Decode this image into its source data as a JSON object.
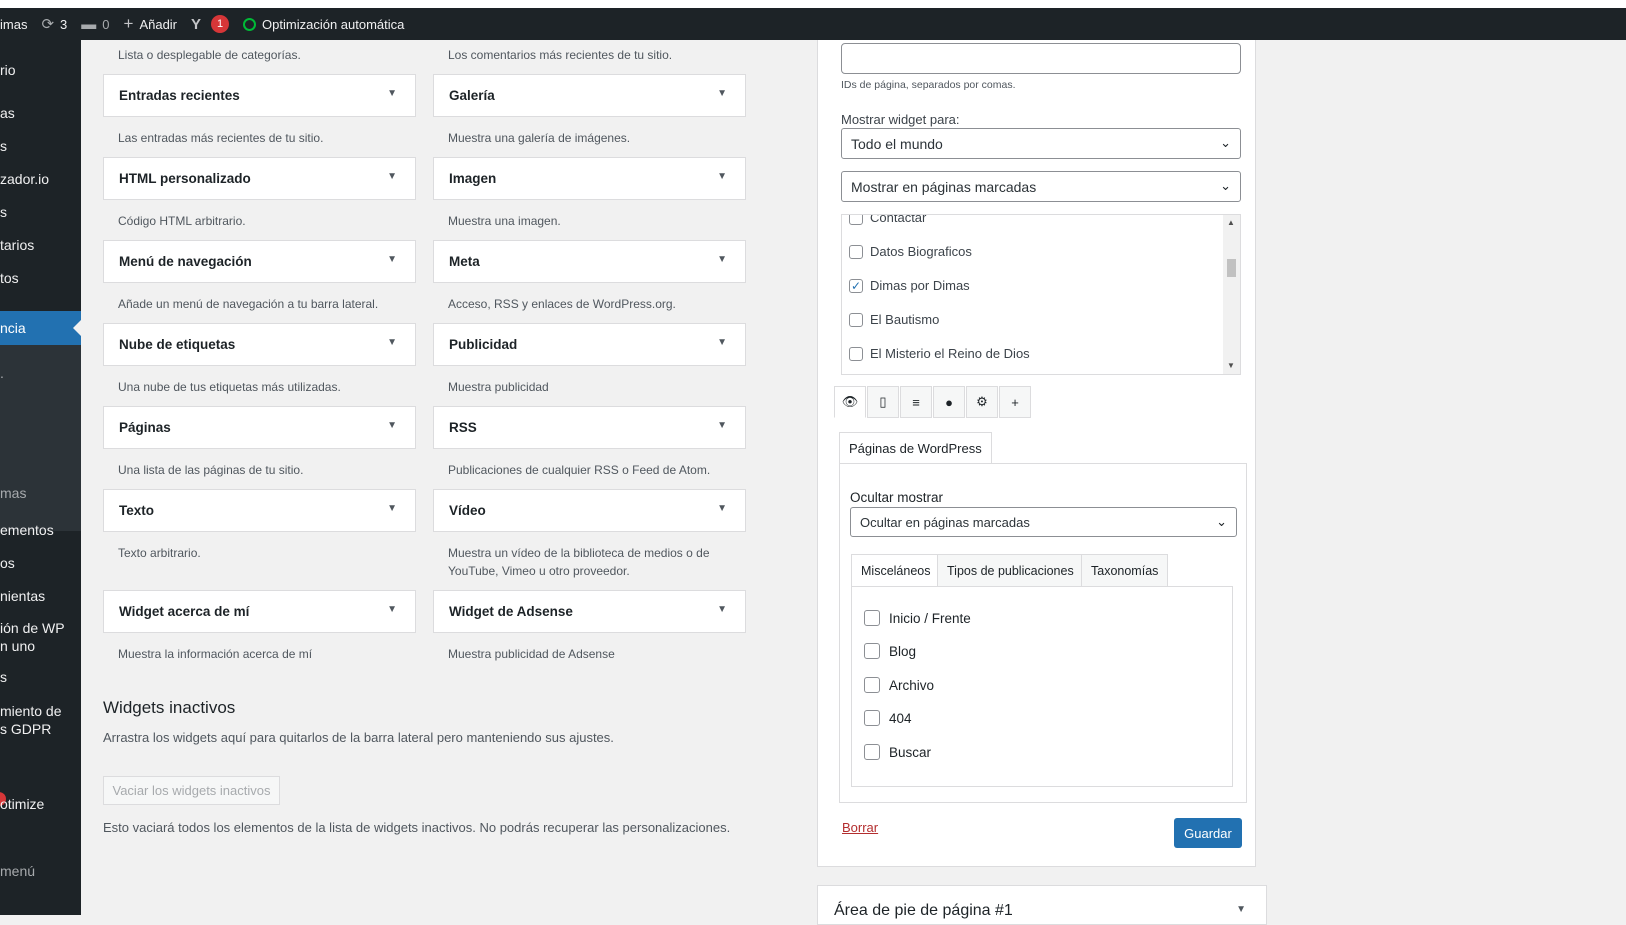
{
  "adminbar": {
    "site_name": "imas",
    "updates_count": "3",
    "comments_count": "0",
    "add_new": "Añadir",
    "yoast_badge": "1",
    "autoptimize": "Optimización automática"
  },
  "sidebar": {
    "items": [
      "rio",
      "as",
      "s",
      "zador.io",
      "s",
      "tarios",
      "tos",
      "ncia",
      ".",
      "mas",
      "ementos",
      "os",
      "nientas",
      "ión de WP",
      "n uno",
      "s",
      "miento de",
      "s GDPR",
      "otimize",
      "menú"
    ]
  },
  "widgets": {
    "top_desc_left": "Lista o desplegable de categorías.",
    "top_desc_right": "Los comentarios más recientes de tu sitio.",
    "left": [
      {
        "title": "Entradas recientes",
        "desc": "Las entradas más recientes de tu sitio."
      },
      {
        "title": "HTML personalizado",
        "desc": "Código HTML arbitrario."
      },
      {
        "title": "Menú de navegación",
        "desc": "Añade un menú de navegación a tu barra lateral."
      },
      {
        "title": "Nube de etiquetas",
        "desc": "Una nube de tus etiquetas más utilizadas."
      },
      {
        "title": "Páginas",
        "desc": "Una lista de las páginas de tu sitio."
      },
      {
        "title": "Texto",
        "desc": "Texto arbitrario."
      },
      {
        "title": "Widget acerca de mí",
        "desc": "Muestra la información acerca de mí"
      }
    ],
    "right": [
      {
        "title": "Galería",
        "desc": "Muestra una galería de imágenes."
      },
      {
        "title": "Imagen",
        "desc": "Muestra una imagen."
      },
      {
        "title": "Meta",
        "desc": "Acceso, RSS y enlaces de WordPress.org."
      },
      {
        "title": "Publicidad",
        "desc": "Muestra publicidad"
      },
      {
        "title": "RSS",
        "desc": "Publicaciones de cualquier RSS o Feed de Atom."
      },
      {
        "title": "Vídeo",
        "desc": "Muestra un vídeo de la biblioteca de medios o de YouTube, Vimeo u otro proveedor."
      },
      {
        "title": "Widget de Adsense",
        "desc": "Muestra publicidad de Adsense"
      }
    ]
  },
  "inactive": {
    "title": "Widgets inactivos",
    "desc": "Arrastra los widgets aquí para quitarlos de la barra lateral pero manteniendo sus ajustes.",
    "clear_button": "Vaciar los widgets inactivos",
    "note": "Esto vaciará todos los elementos de la lista de widgets inactivos. No podrás recuperar las personalizaciones."
  },
  "panel": {
    "page_ids_hint": "IDs de página, separados por comas.",
    "show_for_label": "Mostrar widget para:",
    "show_for_value": "Todo el mundo",
    "show_mode_value": "Mostrar en páginas marcadas",
    "pages": [
      {
        "label": "Contactar",
        "checked": false
      },
      {
        "label": "Datos Biograficos",
        "checked": false
      },
      {
        "label": "Dimas por Dimas",
        "checked": true
      },
      {
        "label": "El Bautismo",
        "checked": false
      },
      {
        "label": "El Misterio el Reino de Dios",
        "checked": false
      }
    ],
    "icon_tabs": [
      "eye-icon",
      "mobile-icon",
      "align-icon",
      "user-icon",
      "gear-icon",
      "plus-icon"
    ],
    "wp_pages_tab": "Páginas de WordPress",
    "hide_show_label": "Ocultar mostrar",
    "hide_show_value": "Ocultar en páginas marcadas",
    "subtabs": [
      "Misceláneos",
      "Tipos de publicaciones",
      "Taxonomías"
    ],
    "misc_options": [
      "Inicio / Frente",
      "Blog",
      "Archivo",
      "404",
      "Buscar"
    ],
    "delete_link": "Borrar",
    "save_button": "Guardar"
  },
  "footer_area": {
    "title": "Área de pie de página #1"
  }
}
